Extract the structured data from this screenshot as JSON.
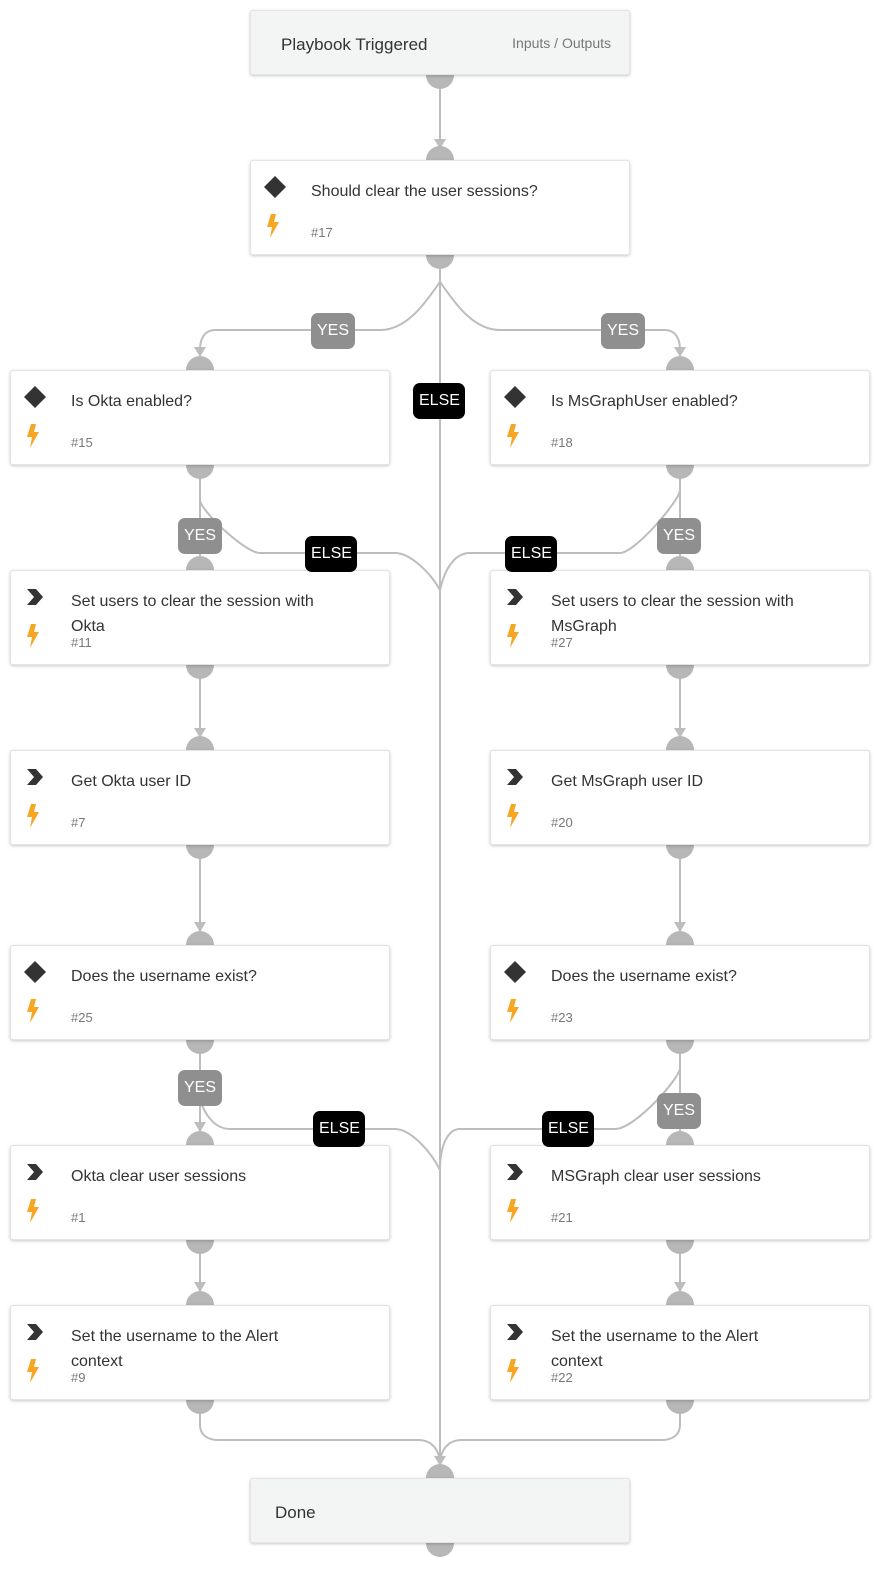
{
  "start": {
    "title": "Playbook Triggered",
    "io_link": "Inputs / Outputs"
  },
  "end": {
    "title": "Done"
  },
  "nodes": {
    "n17": {
      "title": "Should clear the user sessions?",
      "id": "#17",
      "type": "condition"
    },
    "n15": {
      "title": "Is Okta enabled?",
      "id": "#15",
      "type": "condition"
    },
    "n18": {
      "title": "Is MsGraphUser enabled?",
      "id": "#18",
      "type": "condition"
    },
    "n11": {
      "title": "Set users to clear the session with Okta",
      "id": "#11",
      "type": "task"
    },
    "n27": {
      "title": "Set users to clear the session with MsGraph",
      "id": "#27",
      "type": "task"
    },
    "n7": {
      "title": "Get Okta user ID",
      "id": "#7",
      "type": "task"
    },
    "n20": {
      "title": "Get MsGraph user ID",
      "id": "#20",
      "type": "task"
    },
    "n25": {
      "title": "Does the username exist?",
      "id": "#25",
      "type": "condition"
    },
    "n23": {
      "title": "Does the username exist?",
      "id": "#23",
      "type": "condition"
    },
    "n1": {
      "title": "Okta clear user sessions",
      "id": "#1",
      "type": "task"
    },
    "n21": {
      "title": "MSGraph clear user sessions",
      "id": "#21",
      "type": "task"
    },
    "n9": {
      "title": "Set the username to the Alert context",
      "id": "#9",
      "type": "task"
    },
    "n22": {
      "title": "Set the username to the Alert context",
      "id": "#22",
      "type": "task"
    }
  },
  "labels": {
    "yes": "YES",
    "else": "ELSE"
  },
  "colors": {
    "bolt": "#f5a623",
    "yes_badge": "#8f8f8f",
    "else_badge": "#000000",
    "edge": "#bdbdbd",
    "icon": "#333333"
  }
}
